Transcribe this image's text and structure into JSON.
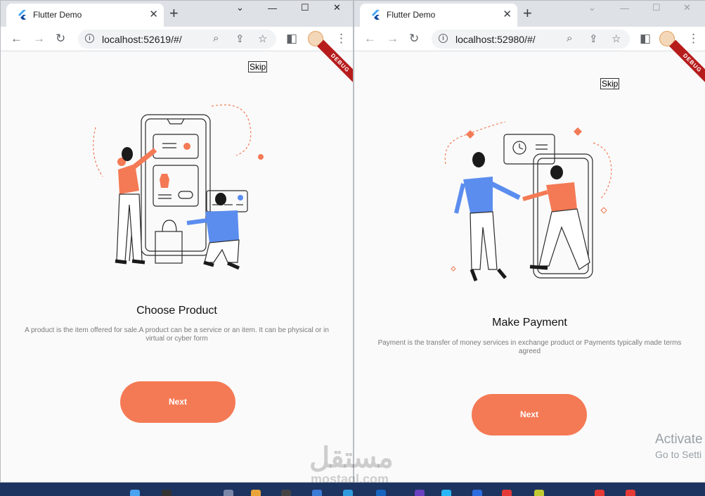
{
  "windows": [
    {
      "tab_title": "Flutter Demo",
      "url": "localhost:52619/#/",
      "debug_label": "DEBUG",
      "skip_label": "Skip",
      "title": "Choose Product",
      "description": "A product is the item offered for sale.A product can be a service or an item. It can be physical or in virtual or cyber form",
      "next_label": "Next",
      "illustration": "shopping-illustration"
    },
    {
      "tab_title": "Flutter Demo",
      "url": "localhost:52980/#/",
      "debug_label": "DEBUG",
      "skip_label": "Skip",
      "title": "Make Payment",
      "description": "Payment is the transfer of money services in exchange product or Payments typically made terms agreed",
      "next_label": "Next",
      "illustration": "payment-illustration"
    }
  ],
  "activation": {
    "line1": "Activate",
    "line2": "Go to Setti"
  },
  "watermark": {
    "arabic": "مستقل",
    "latin": "mostaql.com"
  },
  "colors": {
    "accent": "#f47a55",
    "blue": "#5b8def",
    "chrome_tab": "#dee1e6"
  },
  "icons": [
    "flutter-logo-icon",
    "close-icon",
    "plus-icon",
    "minimize-icon",
    "maximize-icon",
    "chevron-down-icon",
    "back-icon",
    "forward-icon",
    "reload-icon",
    "info-icon",
    "zoom-icon",
    "share-icon",
    "star-icon",
    "sidepanel-icon",
    "avatar",
    "kebab-menu-icon"
  ]
}
